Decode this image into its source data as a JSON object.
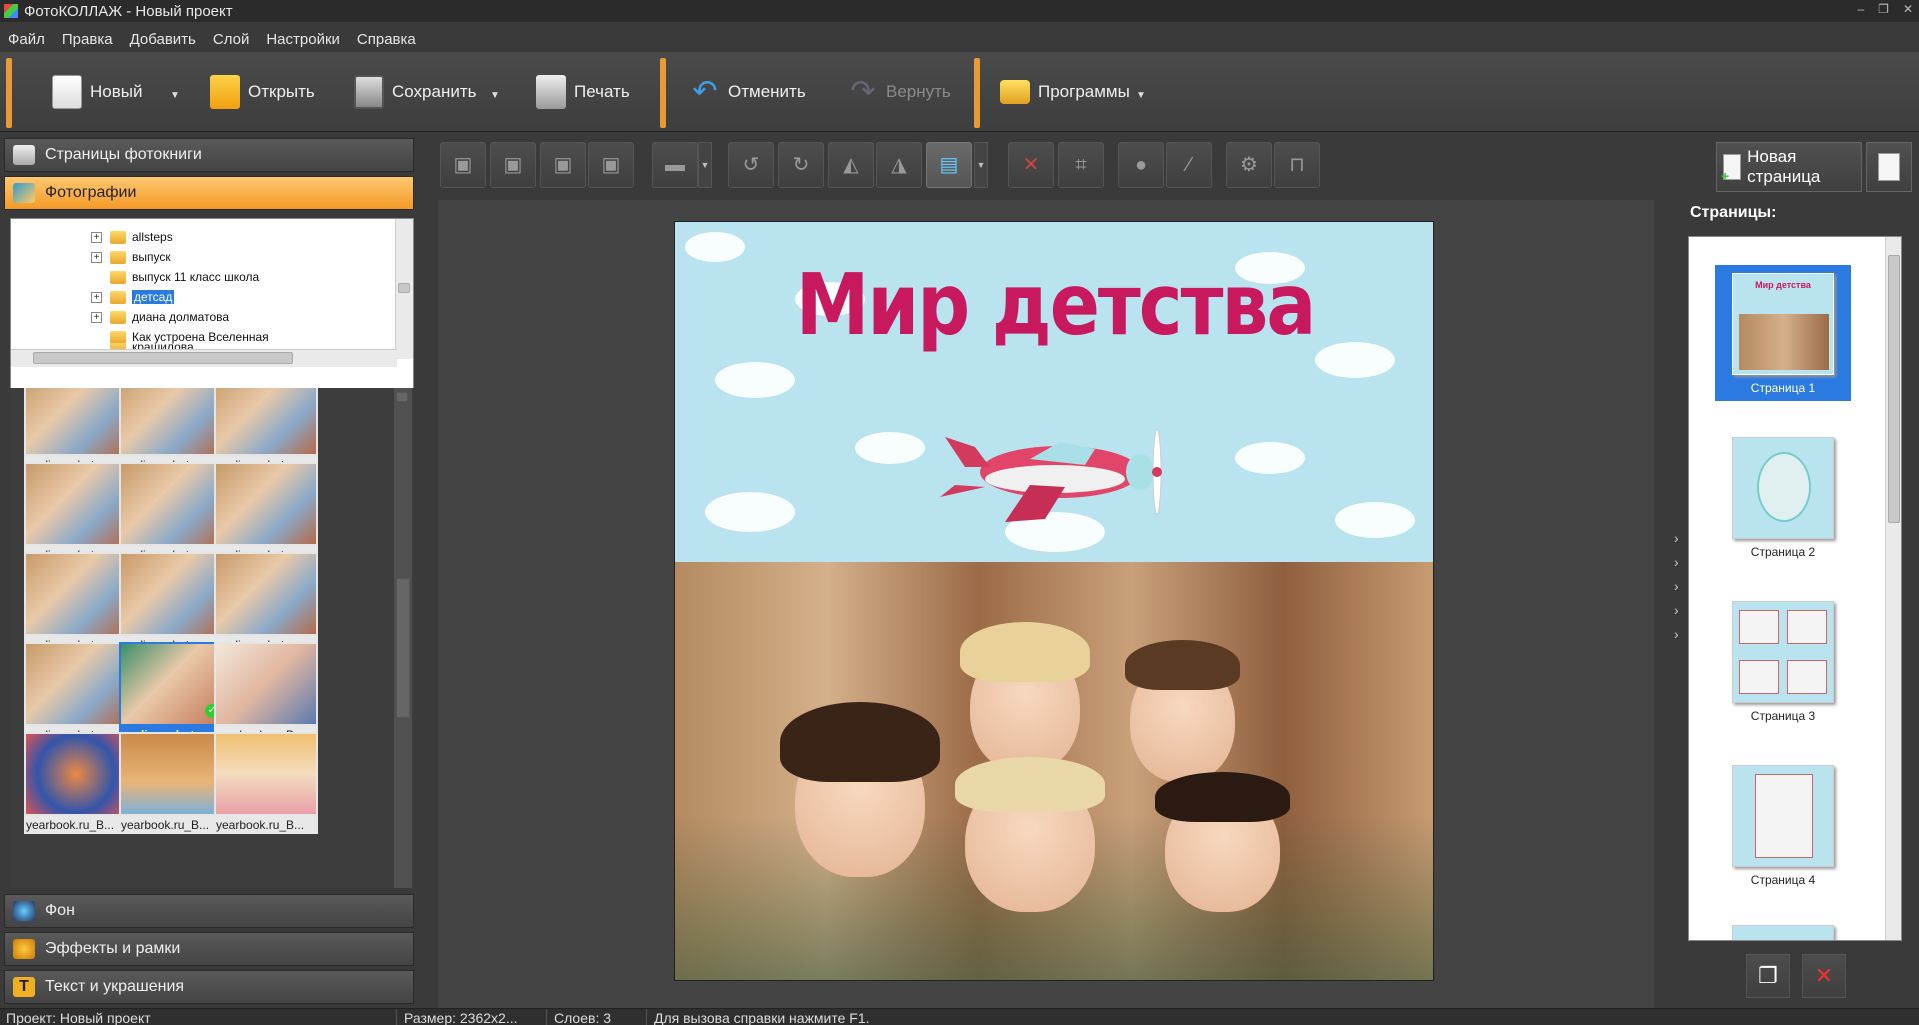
{
  "window": {
    "title": "ФотоКОЛЛАЖ - Новый проект",
    "controls": [
      "–",
      "❐",
      "✕"
    ]
  },
  "menu": [
    "Файл",
    "Правка",
    "Добавить",
    "Слой",
    "Настройки",
    "Справка"
  ],
  "toolbar": {
    "new_label": "Новый",
    "open_label": "Открыть",
    "save_label": "Сохранить",
    "print_label": "Печать",
    "undo_label": "Отменить",
    "redo_label": "Вернуть",
    "programs_label": "Программы"
  },
  "left_panel": {
    "sections": {
      "pages": "Страницы фотокниги",
      "photos": "Фотографии",
      "background": "Фон",
      "effects": "Эффекты и рамки",
      "text": "Текст и украшения"
    },
    "tree": [
      {
        "label": "allsteps",
        "expandable": true,
        "selected": false
      },
      {
        "label": "выпуск",
        "expandable": true,
        "selected": false
      },
      {
        "label": "выпуск 11 класс школа",
        "expandable": false,
        "selected": false
      },
      {
        "label": "детсад",
        "expandable": true,
        "selected": true
      },
      {
        "label": "диана долматова",
        "expandable": true,
        "selected": false
      },
      {
        "label": "Как устроена Вселенная",
        "expandable": false,
        "selected": false
      },
      {
        "label": "крашилова",
        "expandable": false,
        "selected": false
      }
    ],
    "thumbnails": [
      {
        "label": "evelina_photo.r...",
        "selected": false,
        "used": false
      },
      {
        "label": "evelina_photo.r...",
        "selected": false,
        "used": false
      },
      {
        "label": "evelina_photo.r...",
        "selected": false,
        "used": false
      },
      {
        "label": "evelina_photo.r...",
        "selected": false,
        "used": false
      },
      {
        "label": "evelina_photo.r...",
        "selected": false,
        "used": false
      },
      {
        "label": "evelina_photo.r...",
        "selected": false,
        "used": false
      },
      {
        "label": "evelina_photo.r...",
        "selected": false,
        "used": false
      },
      {
        "label": "evelina_photo.r...",
        "selected": false,
        "used": false
      },
      {
        "label": "evelina_photo.r...",
        "selected": false,
        "used": false
      },
      {
        "label": "evelina_photo.r...",
        "selected": false,
        "used": false
      },
      {
        "label": "evelina_phot...",
        "selected": true,
        "used": true
      },
      {
        "label": "yearbook.ru_B...",
        "selected": false,
        "used": false
      },
      {
        "label": "yearbook.ru_B...",
        "selected": false,
        "used": false
      },
      {
        "label": "yearbook.ru_B...",
        "selected": false,
        "used": false
      },
      {
        "label": "yearbook.ru_B...",
        "selected": false,
        "used": false
      }
    ]
  },
  "canvas": {
    "new_page_label": "Новая страница",
    "page_title_text": "Мир детства"
  },
  "pages_panel": {
    "label": "Страницы:",
    "pages": [
      {
        "name": "Страница 1",
        "selected": true
      },
      {
        "name": "Страница 2",
        "selected": false
      },
      {
        "name": "Страница 3",
        "selected": false
      },
      {
        "name": "Страница 4",
        "selected": false
      }
    ]
  },
  "status": {
    "project": "Проект:  Новый проект",
    "size": "Размер:  2362x2...",
    "layers": "Слоев:  3",
    "hint": "Для вызова справки нажмите F1."
  },
  "colors": {
    "accent": "#f39a25",
    "selection": "#2a7ae2",
    "title_pink": "#c8195e",
    "sky": "#b9e3ee"
  }
}
